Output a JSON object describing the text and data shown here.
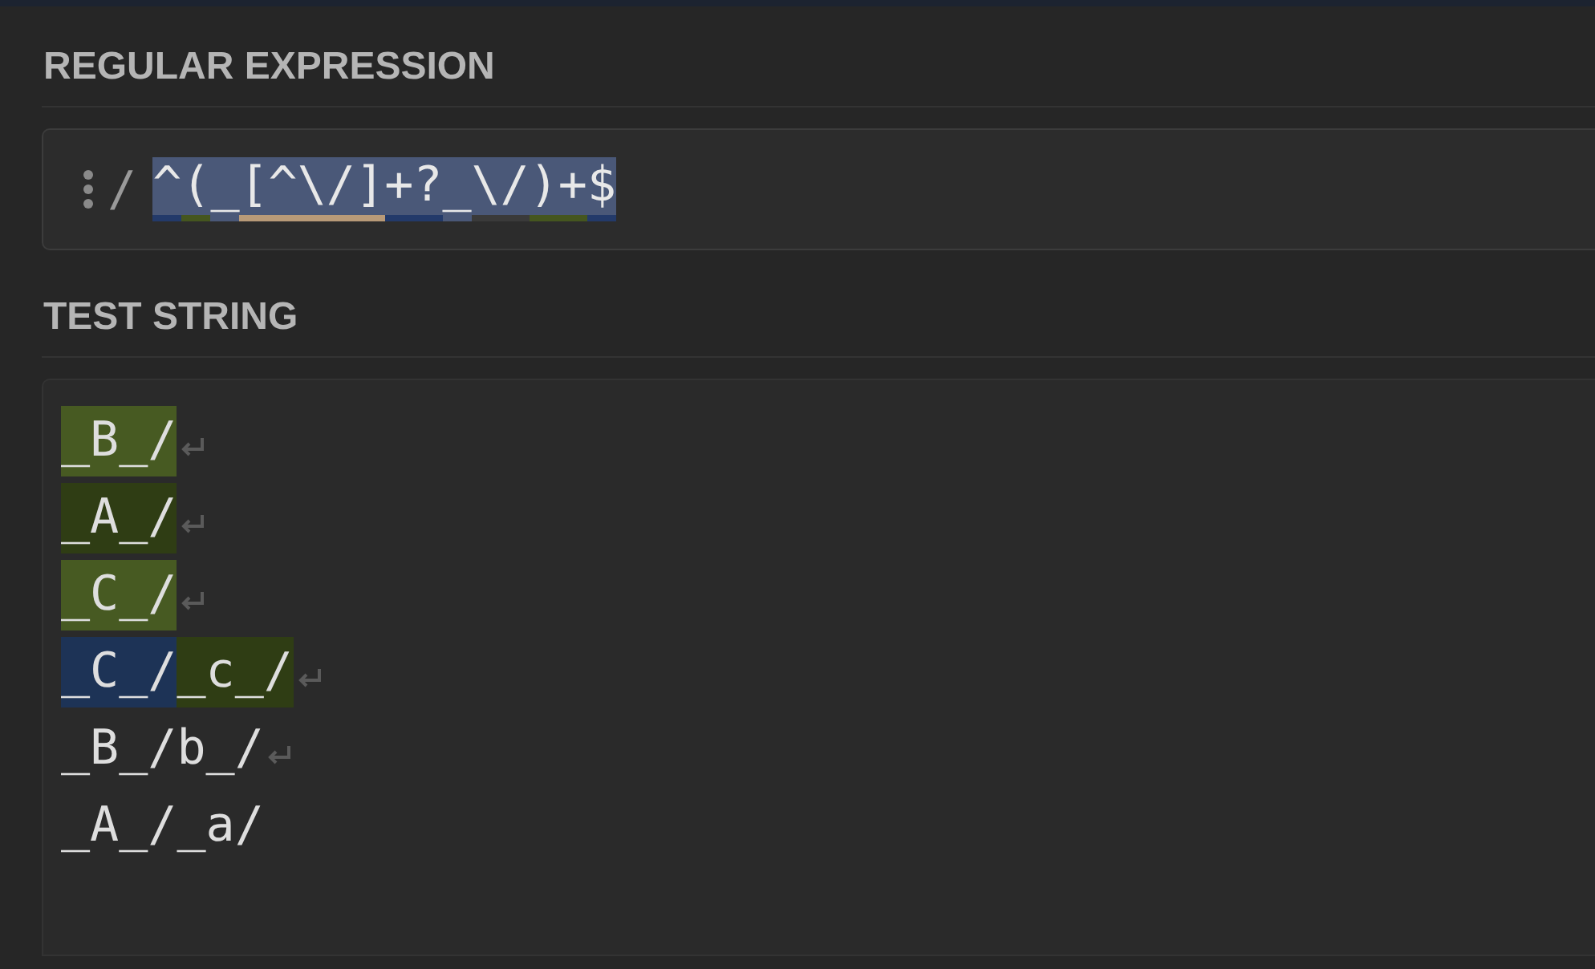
{
  "regex_section": {
    "heading": "REGULAR EXPRESSION",
    "delimiter": "/",
    "tokens": [
      {
        "text": "^",
        "color": "#233a6a"
      },
      {
        "text": "(",
        "color": "#45561f"
      },
      {
        "text": "_"
      },
      {
        "text": "[^\\/]",
        "color": "#b89a78"
      },
      {
        "text": "+?",
        "color": "#233a6a"
      },
      {
        "text": "_"
      },
      {
        "text": "\\/",
        "color": "#3a3a3a"
      },
      {
        "text": ")+",
        "color": "#45561f"
      },
      {
        "text": "$",
        "color": "#233a6a"
      }
    ]
  },
  "test_section": {
    "heading": "TEST STRING",
    "lines": [
      {
        "segments": [
          {
            "text": "_B_/",
            "color": "#475a22"
          }
        ],
        "newline": true
      },
      {
        "segments": [
          {
            "text": "_A_/",
            "color": "#2f3d14"
          }
        ],
        "newline": true
      },
      {
        "segments": [
          {
            "text": "_C_/",
            "color": "#475a22"
          }
        ],
        "newline": true
      },
      {
        "segments": [
          {
            "text": "_C_/",
            "color": "#1d3356"
          },
          {
            "text": "_c_/",
            "color": "#2f3d14"
          }
        ],
        "newline": true
      },
      {
        "segments": [
          {
            "text": "_B_/b_/"
          }
        ],
        "newline": true
      },
      {
        "segments": [
          {
            "text": "_A_/_a/"
          }
        ],
        "newline": false
      }
    ]
  }
}
